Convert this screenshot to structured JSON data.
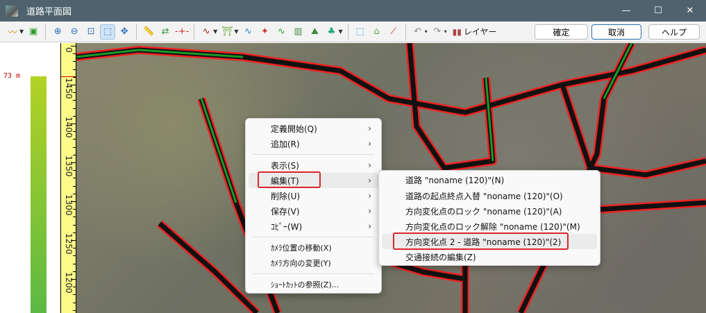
{
  "window": {
    "title": "道路平面図",
    "minimize": "—",
    "maximize": "☐",
    "close": "✕"
  },
  "toolbar": {
    "layer_label": "レイヤー",
    "confirm": "確定",
    "cancel": "取消",
    "help": "ヘルプ"
  },
  "left_panel": {
    "elevation_label": "73 m"
  },
  "ruler": {
    "labels": [
      "0",
      "1450",
      "1400",
      "1350",
      "1300",
      "1250",
      "1200"
    ]
  },
  "context_menu": {
    "items": [
      {
        "label": "定義開始(Q)",
        "submenu": true
      },
      {
        "label": "追加(R)",
        "submenu": true
      },
      {
        "label": "表示(S)",
        "submenu": true
      },
      {
        "label": "編集(T)",
        "submenu": true
      },
      {
        "label": "削除(U)",
        "submenu": true
      },
      {
        "label": "保存(V)",
        "submenu": true
      },
      {
        "label": "ｺﾋﾟｰ(W)",
        "submenu": true
      },
      {
        "label": "ｶﾒﾗ位置の移動(X)"
      },
      {
        "label": "ｶﾒﾗ方向の変更(Y)"
      },
      {
        "label": "ｼｮｰﾄｶｯﾄの参照(Z)..."
      }
    ]
  },
  "submenu": {
    "items": [
      {
        "label": "道路 \"noname (120)\"(N)"
      },
      {
        "label": "道路の起点終点入替  \"noname (120)\"(O)"
      },
      {
        "label": "方向変化点のロック \"noname (120)\"(A)"
      },
      {
        "label": "方向変化点のロック解除 \"noname (120)\"(M)"
      },
      {
        "label": "方向変化点 2 - 道路 \"noname (120)\"(2)"
      },
      {
        "label": "交通接続の編集(Z)"
      }
    ]
  }
}
